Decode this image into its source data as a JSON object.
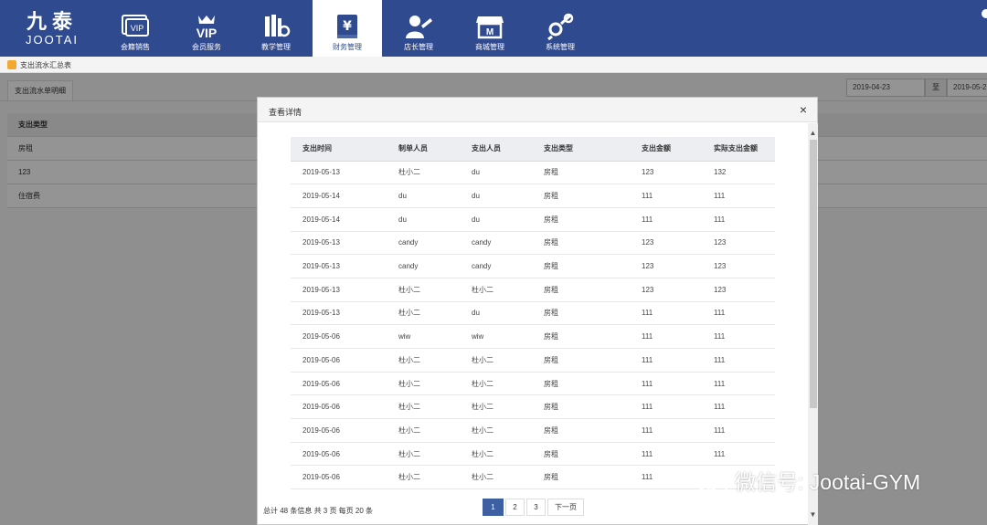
{
  "brand": {
    "name_cn": "九泰",
    "name_en": "JOOTAI"
  },
  "nav": [
    {
      "label": "会籍销售",
      "icon": "vip-card-icon"
    },
    {
      "label": "会员服务",
      "icon": "vip-crown-icon"
    },
    {
      "label": "教学管理",
      "icon": "books-gear-icon"
    },
    {
      "label": "财务管理",
      "icon": "yen-ledger-icon"
    },
    {
      "label": "店长管理",
      "icon": "manager-icon"
    },
    {
      "label": "商城管理",
      "icon": "store-icon"
    },
    {
      "label": "系统管理",
      "icon": "settings-tools-icon"
    }
  ],
  "active_nav": "财务管理",
  "breadcrumb": "支出流水汇总表",
  "background_page": {
    "tab": "支出流水单明细",
    "date_from": "2019-04-23",
    "date_to_label": "至",
    "date_to": "2019-05-2",
    "table_header": "支出类型",
    "rows": [
      "房租",
      "123",
      "住宿费"
    ]
  },
  "modal": {
    "title": "查看详情",
    "close_glyph": "×",
    "columns": [
      "支出时间",
      "制单人员",
      "支出人员",
      "支出类型",
      "支出金额",
      "实际支出金额"
    ],
    "rows": [
      [
        "2019-05-13",
        "杜小二",
        "du",
        "房租",
        "123",
        "132"
      ],
      [
        "2019-05-14",
        "du",
        "du",
        "房租",
        "111",
        "111"
      ],
      [
        "2019-05-14",
        "du",
        "du",
        "房租",
        "111",
        "111"
      ],
      [
        "2019-05-13",
        "candy",
        "candy",
        "房租",
        "123",
        "123"
      ],
      [
        "2019-05-13",
        "candy",
        "candy",
        "房租",
        "123",
        "123"
      ],
      [
        "2019-05-13",
        "杜小二",
        "杜小二",
        "房租",
        "123",
        "123"
      ],
      [
        "2019-05-13",
        "杜小二",
        "du",
        "房租",
        "111",
        "111"
      ],
      [
        "2019-05-06",
        "wiw",
        "wiw",
        "房租",
        "111",
        "111"
      ],
      [
        "2019-05-06",
        "杜小二",
        "杜小二",
        "房租",
        "111",
        "111"
      ],
      [
        "2019-05-06",
        "杜小二",
        "杜小二",
        "房租",
        "111",
        "111"
      ],
      [
        "2019-05-06",
        "杜小二",
        "杜小二",
        "房租",
        "111",
        "111"
      ],
      [
        "2019-05-06",
        "杜小二",
        "杜小二",
        "房租",
        "111",
        "111"
      ],
      [
        "2019-05-06",
        "杜小二",
        "杜小二",
        "房租",
        "111",
        "111"
      ],
      [
        "2019-05-06",
        "杜小二",
        "杜小二",
        "房租",
        "111",
        ""
      ]
    ],
    "footer_info": "总计 48 条信息 共 3 页 每页 20 条",
    "pager": {
      "pages": [
        "1",
        "2",
        "3"
      ],
      "current": "1",
      "next_label": "下一页"
    }
  },
  "watermark": "微信号: Jootai-GYM",
  "colors": {
    "nav_bg": "#2f4a8f",
    "accent": "#3f5fa3",
    "crumb_icon": "#f3a833"
  }
}
